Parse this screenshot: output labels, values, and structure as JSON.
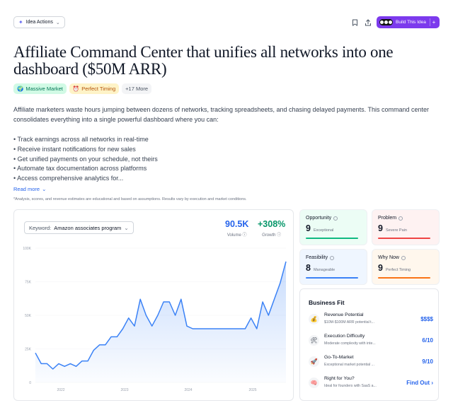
{
  "colors": {
    "accent": "#7c3aed",
    "link": "#2563eb",
    "growth": "#059669",
    "line": "#3b82f6"
  },
  "toolbar": {
    "idea_actions": "Idea Actions",
    "build_label": "Build This Idea",
    "icons": [
      "sparkle-icon",
      "bookmark-icon",
      "share-icon",
      "plus-icon"
    ]
  },
  "title": "Affiliate Command Center that unifies all networks into one dashboard ($50M ARR)",
  "tags": [
    {
      "icon": "🌍",
      "label": "Massive Market"
    },
    {
      "icon": "⏰",
      "label": "Perfect Timing"
    },
    {
      "icon": "",
      "label": "+17 More"
    }
  ],
  "description": "Affiliate marketers waste hours jumping between dozens of networks, tracking spreadsheets, and chasing delayed payments. This command center consolidates everything into a single powerful dashboard where you can:",
  "bullets": [
    "• Track earnings across all networks in real-time",
    "• Receive instant notifications for new sales",
    "• Get unified payments on your schedule, not theirs",
    "• Automate tax documentation across platforms",
    "• Access comprehensive analytics for..."
  ],
  "read_more": "Read more",
  "disclaimer": "*Analysis, scores, and revenue estimates are educational and based on assumptions. Results vary by execution and market conditions.",
  "keyword": {
    "label": "Keyword:",
    "value": "Amazon associates program"
  },
  "stats": {
    "volume": {
      "value": "90.5K",
      "label": "Volume"
    },
    "growth": {
      "value": "+308%",
      "label": "Growth"
    }
  },
  "chart_data": {
    "type": "area",
    "ylim": [
      0,
      100
    ],
    "y_ticks": [
      "0",
      "25K",
      "50K",
      "75K",
      "100K"
    ],
    "x_ticks": [
      "2022",
      "2023",
      "2024",
      "2025"
    ],
    "values": [
      22,
      14,
      14,
      10,
      14,
      12,
      14,
      12,
      16,
      16,
      24,
      28,
      28,
      34,
      34,
      40,
      48,
      42,
      62,
      50,
      42,
      50,
      60,
      60,
      50,
      62,
      42,
      40,
      40,
      40,
      40,
      40,
      40,
      40,
      40,
      40,
      40,
      48,
      40,
      60,
      50,
      62,
      74,
      90
    ]
  },
  "metrics": [
    {
      "title": "Opportunity",
      "score": "9",
      "sub": "Exceptional",
      "bg": "#ecfdf5",
      "bar": "#10b981"
    },
    {
      "title": "Problem",
      "score": "9",
      "sub": "Severe Pain",
      "bg": "#fef2f2",
      "bar": "#ef4444"
    },
    {
      "title": "Feasibility",
      "score": "8",
      "sub": "Manageable",
      "bg": "#eff6ff",
      "bar": "#3b82f6"
    },
    {
      "title": "Why Now",
      "score": "9",
      "sub": "Perfect Timing",
      "bg": "#fff7ed",
      "bar": "#f97316"
    }
  ],
  "business_fit": {
    "title": "Business Fit",
    "rows": [
      {
        "icon": "💰",
        "title": "Revenue Potential",
        "sub": "$10M-$100M ARR potential t...",
        "value": "$$$$"
      },
      {
        "icon": "🛠",
        "title": "Execution Difficulty",
        "sub": "Moderate complexity with inte...",
        "value": "6/10"
      },
      {
        "icon": "🚀",
        "title": "Go-To-Market",
        "sub": "Exceptional market potential ...",
        "value": "9/10"
      },
      {
        "icon": "🧠",
        "title": "Right for You?",
        "sub": "Ideal for founders with SaaS a...",
        "value": "Find Out"
      }
    ]
  }
}
